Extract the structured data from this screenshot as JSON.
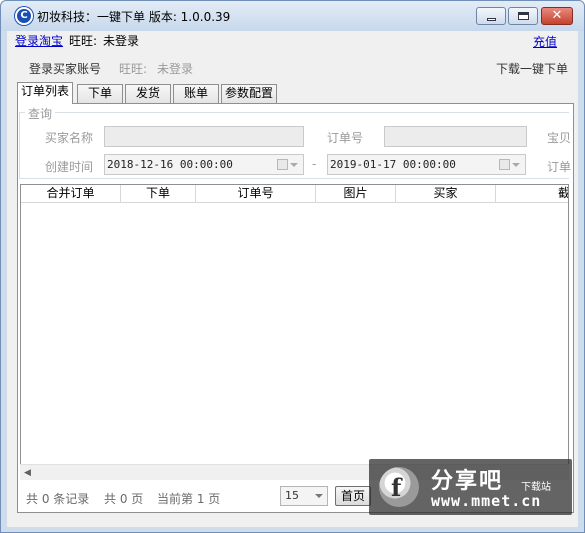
{
  "window": {
    "title": "初妆科技：一键下单   版本: 1.0.0.39"
  },
  "topbar": {
    "login_taobao": "登录淘宝",
    "wangwang_label": "旺旺:",
    "wangwang_status": "未登录",
    "recharge": "充值",
    "login_buyer": "登录买家账号",
    "buyer_wangwang_label": "旺旺:",
    "buyer_wangwang_status": "未登录",
    "download_oneclick": "下载一键下单"
  },
  "tabs": [
    {
      "label": "订单列表",
      "active": true
    },
    {
      "label": "下单",
      "active": false
    },
    {
      "label": "发货",
      "active": false
    },
    {
      "label": "账单",
      "active": false
    },
    {
      "label": "参数配置",
      "active": false
    }
  ],
  "query": {
    "legend": "查询",
    "buyer_name_label": "买家名称",
    "buyer_name_value": "",
    "order_no_label": "订单号",
    "order_no_value": "",
    "baby_label": "宝贝",
    "created_time_label": "创建时间",
    "date_from": "2018-12-16 00:00:00",
    "date_separator": "-",
    "date_to": "2019-01-17 00:00:00",
    "order_label_right": "订单"
  },
  "grid": {
    "columns": [
      "合并订单",
      "下单",
      "订单号",
      "图片",
      "买家",
      "截"
    ]
  },
  "footer": {
    "total_records": "共 0 条记录",
    "total_pages": "共 0 页",
    "current_page": "当前第 1 页",
    "page_size": "15",
    "first_page": "首页"
  },
  "watermark": {
    "logo_letter": "f",
    "name": "分享吧",
    "sub": "下载站",
    "url": "www.mmet.cn"
  }
}
